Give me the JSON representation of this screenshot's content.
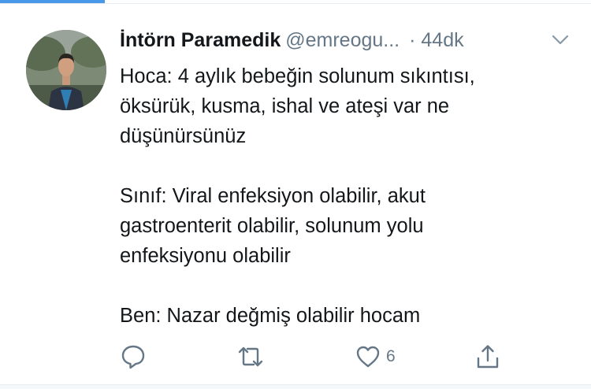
{
  "colors": {
    "accent": "#4a99e9",
    "text_primary": "#14171a",
    "text_secondary": "#657786",
    "icon": "#657786",
    "divider": "#e6ecf0"
  },
  "tweet": {
    "display_name": "İntörn Paramedik",
    "username": "@emreogu...",
    "timestamp": "· 44dk",
    "menu_icon": "chevron-down-icon",
    "lines": [
      "Hoca: 4 aylık bebeğin solunum sıkıntısı,",
      "öksürük, kusma, ishal ve ateşi var ne",
      "düşünürsünüz",
      "",
      "Sınıf: Viral enfeksiyon olabilir, akut",
      "gastroenterit olabilir, solunum yolu",
      "enfeksiyonu olabilir",
      "",
      "Ben: Nazar değmiş olabilir hocam"
    ],
    "actions": {
      "reply_icon": "reply-icon",
      "retweet_icon": "retweet-icon",
      "like_icon": "heart-icon",
      "like_count": "6",
      "share_icon": "share-icon"
    }
  }
}
